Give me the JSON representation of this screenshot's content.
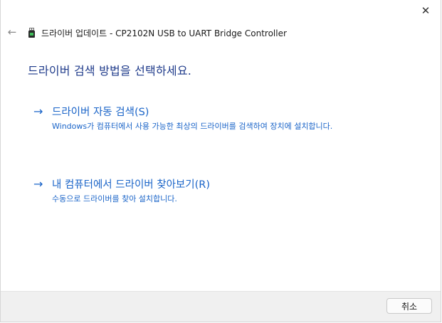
{
  "window": {
    "title": "드라이버 업데이트 - CP2102N USB to UART Bridge Controller",
    "close_glyph": "✕",
    "back_glyph": "←"
  },
  "main": {
    "heading": "드라이버 검색 방법을 선택하세요.",
    "options": [
      {
        "arrow": "→",
        "label": "드라이버 자동 검색(S)",
        "description": "Windows가 컴퓨터에서 사용 가능한 최상의 드라이버를 검색하여 장치에 설치합니다."
      },
      {
        "arrow": "→",
        "label": "내 컴퓨터에서 드라이버 찾아보기(R)",
        "description": "수동으로 드라이버를 찾아 설치합니다."
      }
    ]
  },
  "footer": {
    "cancel_label": "취소"
  },
  "colors": {
    "accent": "#1a64c8",
    "heading": "#1e3a8a",
    "footer_bg": "#f0f0f0"
  },
  "icons": {
    "device": "usb-device-icon",
    "back": "back-arrow-icon",
    "close": "close-icon"
  }
}
